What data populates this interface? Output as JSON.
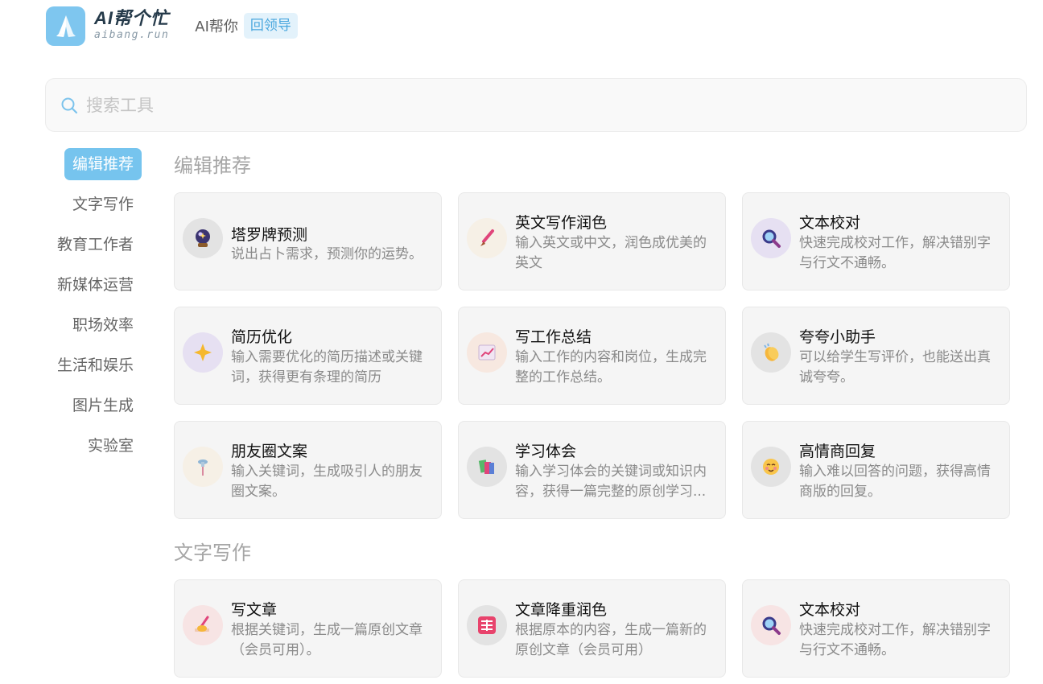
{
  "header": {
    "logo_title": "AI帮个忙",
    "logo_sub": "aibang.run",
    "tagline": "AI帮你",
    "back_label": "回领导"
  },
  "search": {
    "placeholder": "搜索工具"
  },
  "sidebar": {
    "items": [
      {
        "label": "编辑推荐"
      },
      {
        "label": "文字写作"
      },
      {
        "label": "教育工作者"
      },
      {
        "label": "新媒体运营"
      },
      {
        "label": "职场效率"
      },
      {
        "label": "生活和娱乐"
      },
      {
        "label": "图片生成"
      },
      {
        "label": "实验室"
      }
    ]
  },
  "sections": [
    {
      "title": "编辑推荐",
      "cards": [
        {
          "title": "塔罗牌预测",
          "desc": "说出占卜需求，预测你的运势。",
          "icon": "crystal-ball-icon"
        },
        {
          "title": "英文写作润色",
          "desc": "输入英文或中文，润色成优美的英文",
          "icon": "paintbrush-icon"
        },
        {
          "title": "文本校对",
          "desc": "快速完成校对工作，解决错别字与行文不通畅。",
          "icon": "magnifier-icon"
        },
        {
          "title": "简历优化",
          "desc": "输入需要优化的简历描述或关键词，获得更有条理的简历",
          "icon": "sparkle-icon"
        },
        {
          "title": "写工作总结",
          "desc": "输入工作的内容和岗位，生成完整的工作总结。",
          "icon": "chart-icon"
        },
        {
          "title": "夸夸小助手",
          "desc": "可以给学生写评价，也能送出真诚夸夸。",
          "icon": "clap-icon"
        },
        {
          "title": "朋友圈文案",
          "desc": "输入关键词，生成吸引人的朋友圈文案。",
          "icon": "pin-icon"
        },
        {
          "title": "学习体会",
          "desc": "输入学习体会的关键词或知识内容，获得一篇完整的原创学习...",
          "icon": "books-icon"
        },
        {
          "title": "高情商回复",
          "desc": "输入难以回答的问题，获得高情商版的回复。",
          "icon": "smile-icon"
        }
      ]
    },
    {
      "title": "文字写作",
      "cards": [
        {
          "title": "写文章",
          "desc": "根据关键词，生成一篇原创文章（会员可用）。",
          "icon": "writing-hand-icon"
        },
        {
          "title": "文章降重润色",
          "desc": "根据原本的内容，生成一篇新的原创文章（会员可用）",
          "icon": "full-badge-icon"
        },
        {
          "title": "文本校对",
          "desc": "快速完成校对工作，解决错别字与行文不通畅。",
          "icon": "magnifier-icon"
        }
      ]
    }
  ]
}
